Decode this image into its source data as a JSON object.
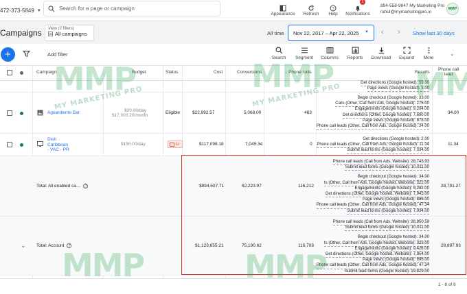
{
  "topbar": {
    "account_id": "472-373-5849",
    "search_placeholder": "Search for a page or campaign",
    "buttons": [
      {
        "label": "Appearance",
        "icon": "appearance-icon"
      },
      {
        "label": "Refresh",
        "icon": "refresh-icon"
      },
      {
        "label": "Help",
        "icon": "help-icon"
      },
      {
        "label": "Notifications",
        "icon": "bell-icon",
        "badge": "1"
      }
    ],
    "user_phone_name": "894-558-9647 My Marketing Pro",
    "user_email": "rahul@mymarketingpro.in",
    "avatar_text": "MMP"
  },
  "header": {
    "title": "Campaigns",
    "filter_line1": "View (2 filters)",
    "filter_line2": "All campaigns",
    "all_time": "All time",
    "date_range": "Nov 22, 2017 – Apr 22, 2025",
    "show_last": "Show last 30 days"
  },
  "toolbar": {
    "add_filter": "Add filter",
    "tools": [
      {
        "label": "Search",
        "icon": "search-icon"
      },
      {
        "label": "Segment",
        "icon": "segment-icon"
      },
      {
        "label": "Columns",
        "icon": "columns-icon"
      },
      {
        "label": "Reports",
        "icon": "reports-icon"
      },
      {
        "label": "Download",
        "icon": "download-icon"
      },
      {
        "label": "Expand",
        "icon": "expand-icon"
      },
      {
        "label": "More",
        "icon": "more-icon"
      }
    ]
  },
  "table": {
    "headers": {
      "campaign": "Campaign",
      "budget": "Budget",
      "status": "Status",
      "cost": "Cost",
      "conversions": "Conversions",
      "phone_calls": "Phone calls",
      "results": "Results",
      "phone_call_lead_1": "Phone call",
      "phone_call_lead_2": "lead"
    },
    "top_partial_results": [
      "Get directions (Google hosted): 59.00",
      "Page views (Google hosted): 3.00"
    ],
    "rows": [
      {
        "campaign": "Aguardiente Bar",
        "budget_1": "$20.00/day",
        "budget_2": "$17,003.20/month",
        "status": "Eligible",
        "cost": "$22,992.57",
        "conversions": "5,068.00",
        "phone_calls": "483",
        "lead": "34.00",
        "results": [
          "Begin checkout (Google hosted): 33.00",
          "Calls (Other, Call from Ads, Google hosted): 275.00",
          "Engagements (Google hosted): 9,204.00",
          "Get directions (Other, Google hosted): 7,690.00",
          "Page views (Google hosted): 878.00",
          "Phone call leads (Other, Call from Ads, Google hosted): 34.00"
        ]
      },
      {
        "campaign_1": "Dish",
        "campaign_2": "Caribbean",
        "campaign_3": "- VAC - PR",
        "budget_1": "$150.00/day",
        "status": "Li",
        "cost": "$117,098.18",
        "conversions": "7,045.34",
        "phone_calls": "0",
        "lead": "11.34",
        "results": [
          "Get directions (Google hosted): 2.00",
          "Phone call leads (Other, Call from Ads, Google hosted): 11.34",
          "Submit lead forms (Google hosted): 7,034.00"
        ]
      }
    ],
    "totals": [
      {
        "label": "Total: All enabled ca…",
        "cost": "$894,507.71",
        "conversions": "62,223.97",
        "phone_calls": "116,212",
        "lead": "28,791.27",
        "results": [
          "Phone call leads (Call from Ads, Website): 28,743.93",
          "Submit lead forms (Google hosted): 10,011.00",
          "",
          "Begin checkout (Google hosted): 34.00",
          "ts (Other, Call from Ads, Google hosted, Website): 322.00",
          "Engagements (Google hosted): 9,282.00",
          "Get directions (Other, Google hosted, Website): 7,943.00",
          "Page views (Google hosted): 886.00",
          "Phone call leads (Other, Call from Ads, Google hosted): 47.34",
          "Submit lead forms (Google hosted): 7,034.00"
        ]
      },
      {
        "label": "Total: Account",
        "cost": "$1,123,655.21",
        "conversions": "75,190.62",
        "phone_calls": "116,708",
        "lead": "28,897.93",
        "results": [
          "Phone call leads (Call from Ads, Website): 28,850.59",
          "Submit lead forms (Google hosted): 10,011.00",
          "",
          "Begin checkout (Google hosted): 34.00",
          "ts (Other, Call from Ads, Google hosted, Website): 323.00",
          "Engagements (Google hosted): 9,426.00",
          "Get directions (Other, Google hosted, Website): 7,954.00",
          "Page views (Google hosted): 896.00",
          "Phone call leads (Other, Call from Ads, Google hosted): 47.34",
          "Submit lead forms (Google hosted): 19,829.00"
        ]
      }
    ]
  },
  "pager": {
    "text": "1 - 8 of 8"
  },
  "watermark": {
    "big": "MMP",
    "small": "MY MARKETING PRO"
  },
  "colors": {
    "accent": "#1a73e8",
    "highlight_border": "#d93025",
    "enabled_dot": "#188038",
    "watermark": "#34a853"
  }
}
